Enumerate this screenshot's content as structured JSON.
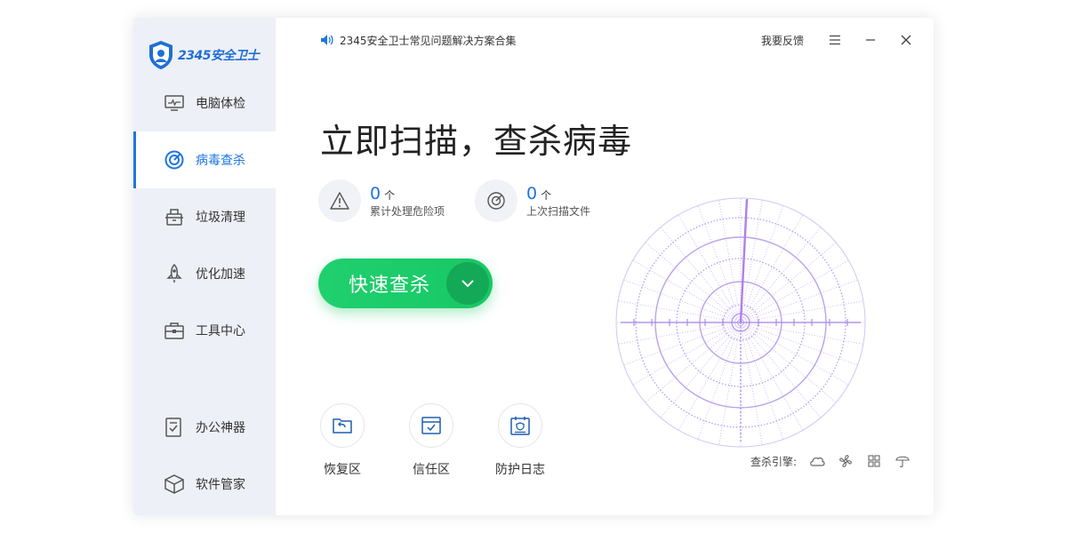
{
  "brand": {
    "name": "2345安全卫士"
  },
  "notice": {
    "text": "2345安全卫士常见问题解决方案合集",
    "icon": "speaker-icon"
  },
  "header": {
    "feedback": "我要反馈"
  },
  "sidebar": {
    "items": [
      {
        "label": "电脑体检",
        "icon": "monitor-icon"
      },
      {
        "label": "病毒查杀",
        "icon": "target-icon",
        "active": true
      },
      {
        "label": "垃圾清理",
        "icon": "trash-icon"
      },
      {
        "label": "优化加速",
        "icon": "rocket-icon"
      },
      {
        "label": "工具中心",
        "icon": "toolbox-icon"
      },
      {
        "label": "办公神器",
        "icon": "document-check-icon"
      },
      {
        "label": "软件管家",
        "icon": "cube-icon"
      }
    ]
  },
  "main": {
    "headline": "立即扫描，查杀病毒",
    "stats": [
      {
        "value": "0",
        "unit": "个",
        "label": "累计处理危险项",
        "icon": "warning-icon"
      },
      {
        "value": "0",
        "unit": "个",
        "label": "上次扫描文件",
        "icon": "radar-icon"
      }
    ],
    "scan_button": "快速查杀",
    "tools": [
      {
        "label": "恢复区",
        "icon": "folder-restore-icon"
      },
      {
        "label": "信任区",
        "icon": "trust-box-icon"
      },
      {
        "label": "防护日志",
        "icon": "calendar-log-icon"
      }
    ],
    "engine": {
      "label": "查杀引擎:"
    }
  },
  "colors": {
    "accent": "#1d74e0",
    "scan_green": "#1fce6c",
    "sidebar_bg": "#eef0f7",
    "radar": "#a98ce8"
  }
}
